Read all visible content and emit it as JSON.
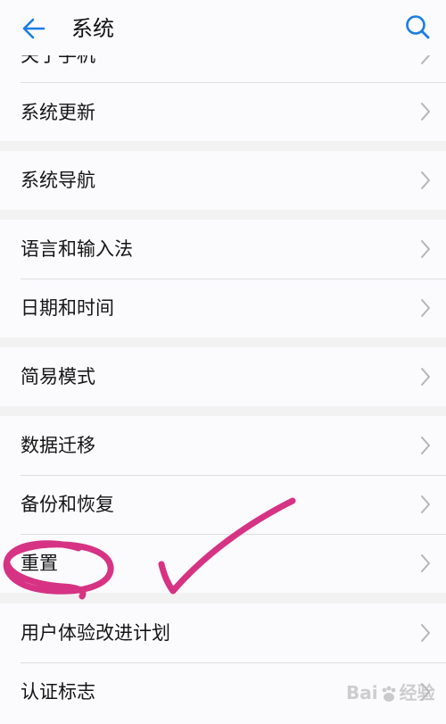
{
  "header": {
    "title": "系统",
    "back_icon": "arrow-left-icon",
    "search_icon": "search-icon",
    "accent_color": "#1a7de6"
  },
  "list": {
    "partial_item_label": "关于手机",
    "items": [
      {
        "label": "系统更新"
      },
      {
        "label": "系统导航"
      },
      {
        "label": "语言和输入法"
      },
      {
        "label": "日期和时间"
      },
      {
        "label": "简易模式"
      },
      {
        "label": "数据迁移"
      },
      {
        "label": "备份和恢复"
      },
      {
        "label": "重置"
      },
      {
        "label": "用户体验改进计划"
      },
      {
        "label": "认证标志"
      }
    ],
    "chevron_icon": "chevron-right-icon"
  },
  "annotation": {
    "color": "#d63384",
    "marks": [
      "circle-mark",
      "checkmark"
    ]
  },
  "watermark": {
    "text_left": "Bai",
    "text_right": "经验"
  }
}
